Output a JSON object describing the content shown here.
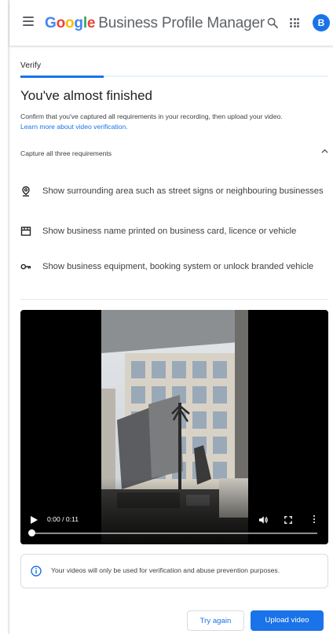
{
  "header": {
    "logo_letters": [
      {
        "ch": "G",
        "color": "#4285F4"
      },
      {
        "ch": "o",
        "color": "#EA4335"
      },
      {
        "ch": "o",
        "color": "#FBBC05"
      },
      {
        "ch": "g",
        "color": "#4285F4"
      },
      {
        "ch": "l",
        "color": "#34A853"
      },
      {
        "ch": "e",
        "color": "#EA4335"
      }
    ],
    "product_name": "Business Profile Manager",
    "avatar_letter": "B",
    "icons": [
      "menu-icon",
      "search-icon",
      "apps-icon"
    ]
  },
  "step": {
    "label": "Verify",
    "progress": 0.27
  },
  "main": {
    "title": "You've almost finished",
    "description": "Confirm that you've captured all requirements in your recording, then upload your video.",
    "learn_more": "Learn more about video verification.",
    "capture_header": "Capture all three requirements",
    "requirements": [
      {
        "icon": "location-pin-icon",
        "text": "Show surrounding area such as street signs or neighbouring businesses"
      },
      {
        "icon": "storefront-icon",
        "text": "Show business name printed on business card, licence or vehicle"
      },
      {
        "icon": "key-icon",
        "text": "Show business equipment, booking system or unlock branded vehicle"
      }
    ]
  },
  "video": {
    "time": "0:00 / 0:11",
    "progress": 0
  },
  "info": {
    "text": "Your videos will only be used for verification and abuse prevention purposes."
  },
  "actions": {
    "try_again": "Try again",
    "upload": "Upload video"
  },
  "colors": {
    "accent": "#1a73e8",
    "text_secondary": "#3c4043"
  }
}
